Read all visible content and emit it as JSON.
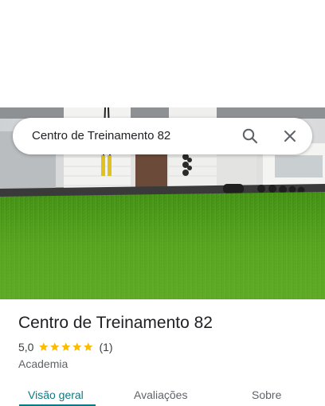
{
  "search": {
    "query": "Centro de Treinamento 82"
  },
  "place": {
    "name": "Centro de Treinamento 82",
    "rating": "5,0",
    "stars": 5,
    "review_count": "(1)",
    "category": "Academia"
  },
  "tabs": [
    {
      "label": "Visão geral",
      "active": true
    },
    {
      "label": "Avaliações",
      "active": false
    },
    {
      "label": "Sobre",
      "active": false
    }
  ],
  "colors": {
    "accent": "#0b7a86",
    "star": "#fbbc04",
    "turf": "#4f9a1c"
  },
  "icons": [
    "search-icon",
    "close-icon",
    "star-icon"
  ]
}
